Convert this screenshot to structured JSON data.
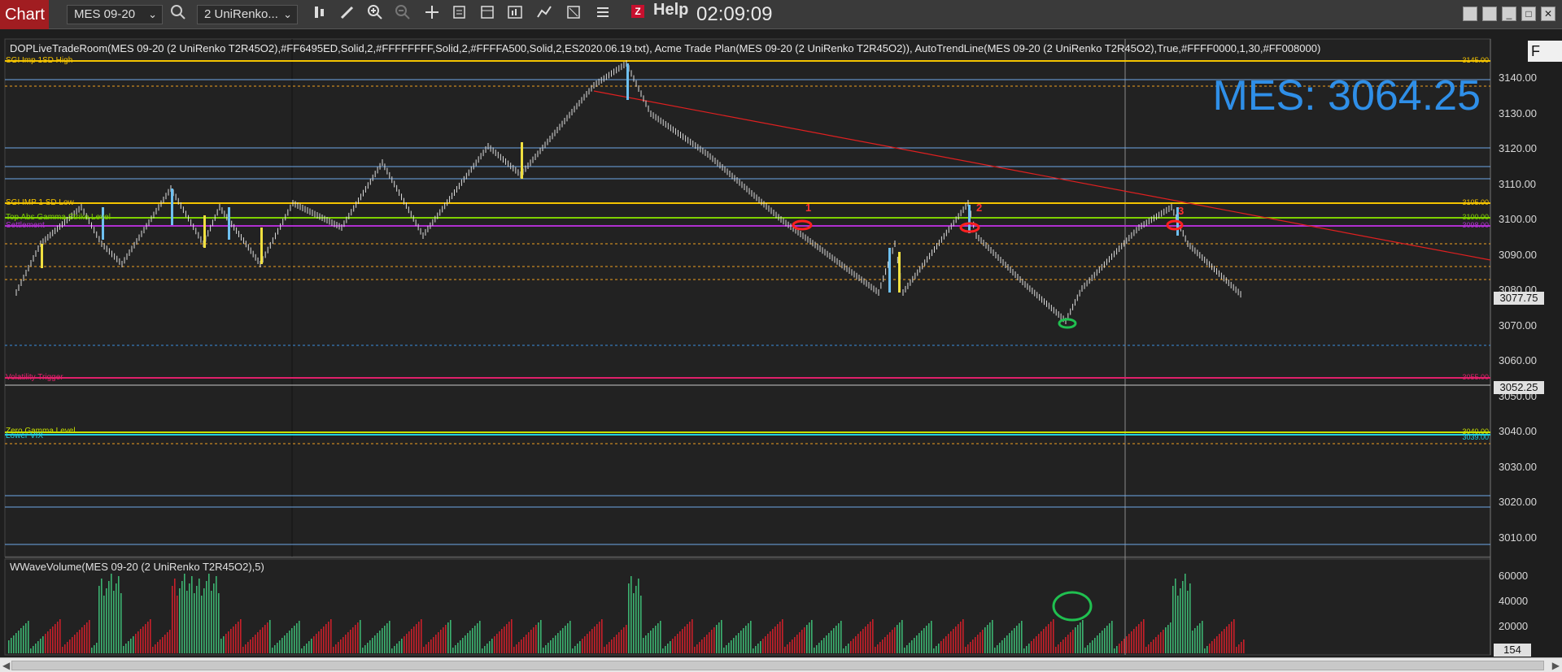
{
  "toolbar": {
    "chart_tab": "Chart",
    "instrument": "MES 09-20",
    "period": "2 UniRenko...",
    "help": "Help",
    "clock": "02:09:09",
    "icons": [
      "search-icon",
      "bar-style-icon",
      "draw-pencil-icon",
      "zoom-in-icon",
      "zoom-out-icon",
      "crosshair-icon",
      "data-box-icon",
      "templates-icon",
      "strategies-icon",
      "indicators-icon",
      "properties-icon",
      "menu-icon"
    ]
  },
  "chart": {
    "indicator_line": "DOPLiveTradeRoom(MES 09-20 (2 UniRenko T2R45O2),#FF6495ED,Solid,2,#FFFFFFFF,Solid,2,#FFFFA500,Solid,2,ES2020.06.19.txt), Acme Trade Plan(MES 09-20 (2 UniRenko T2R45O2)), AutoTrendLine(MES 09-20 (2 UniRenko T2R45O2),True,#FFFF0000,1,30,#FF008000)",
    "big_price": "MES: 3064.25",
    "price_axis": [
      "3140.00",
      "3130.00",
      "3120.00",
      "3110.00",
      "3100.00",
      "3090.00",
      "3080.00",
      "3070.00",
      "3060.00",
      "3050.00",
      "3040.00",
      "3030.00",
      "3020.00",
      "3010.00"
    ],
    "price_tags": [
      "3077.75",
      "3052.25"
    ],
    "levels": [
      {
        "name": "SGI Imp 1SD High",
        "color": "#f5c400",
        "tag": "3145.00"
      },
      {
        "name": "SGI IMP 1 SD Low",
        "color": "#f5c400",
        "tag": "3105.00"
      },
      {
        "name": "Top Abs Gamma Strike Level",
        "color": "#7fd000",
        "tag": "3100.00"
      },
      {
        "name": "Settlement",
        "color": "#b030d0",
        "tag": "3098.00"
      },
      {
        "name": "Volatility Trigger",
        "color": "#e0206a",
        "tag": "3055.00"
      },
      {
        "name": "Zero Gamma Level",
        "color": "#c8e000",
        "tag": "3040.00"
      },
      {
        "name": "Lower VIX",
        "color": "#20d0e0",
        "tag": "3039.00"
      }
    ],
    "markers": [
      "1",
      "2",
      "3"
    ]
  },
  "volume_panel": {
    "label": "WWaveVolume(MES 09-20 (2 UniRenko T2R45O2),5)",
    "axis": [
      "60000",
      "40000",
      "20000"
    ],
    "current_tag": "154"
  },
  "right_panel": {
    "label": "F"
  },
  "colors": {
    "chart_tab": "#a11d21",
    "big_price": "#2f8fe8",
    "up_volume": "#3cb371",
    "down_volume": "#c8202a"
  }
}
